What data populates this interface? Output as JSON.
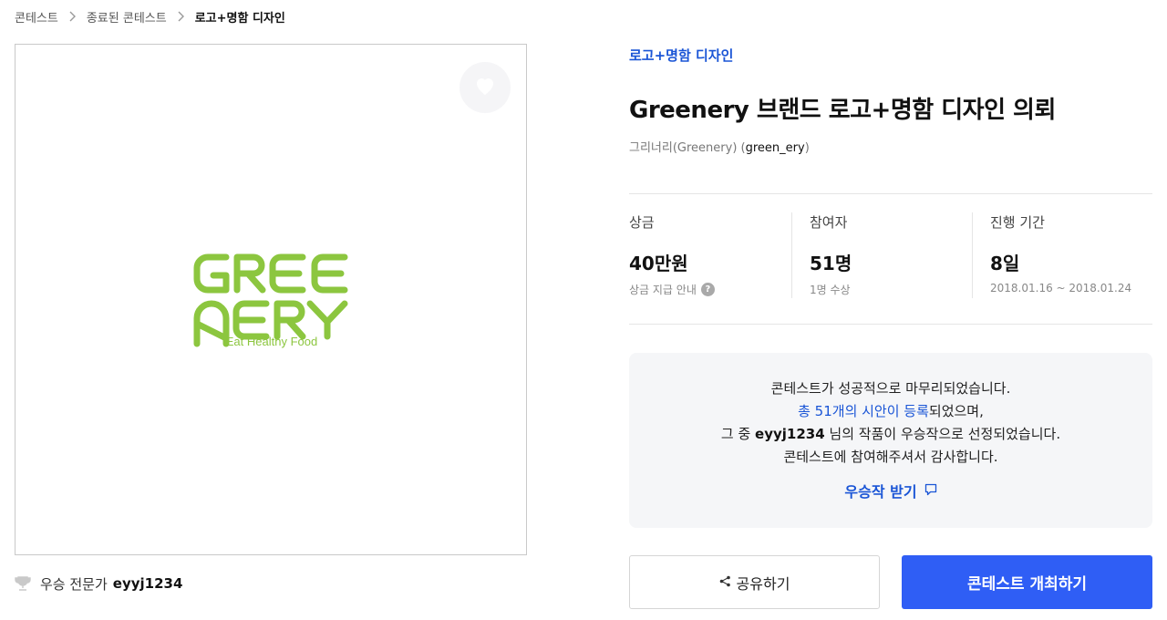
{
  "breadcrumb": {
    "items": [
      "콘테스트",
      "종료된 콘테스트",
      "로고+명함 디자인"
    ]
  },
  "contest": {
    "category": "로고+명함 디자인",
    "title": "Greenery 브랜드 로고+명함 디자인 의뢰",
    "organizer_name": "그리너리(Greenery)",
    "organizer_id": "green_ery"
  },
  "artwork": {
    "logo_line1": "GREE",
    "logo_line2": "NERY",
    "tagline": "Eat Healthy Food",
    "brand_color": "#8cc63f"
  },
  "winner": {
    "label": "우승 전문가",
    "name": "eyyj1234"
  },
  "stats": {
    "prize": {
      "label": "상금",
      "value": "40만원",
      "sub": "상금 지급 안내",
      "help": "?"
    },
    "participants": {
      "label": "참여자",
      "value": "51명",
      "sub": "1명 수상"
    },
    "period": {
      "label": "진행 기간",
      "value": "8일",
      "sub": "2018.01.16 ~ 2018.01.24"
    }
  },
  "result": {
    "line1": "콘테스트가 성공적으로 마무리되었습니다.",
    "line2_link": "총 51개의 시안이 등록",
    "line2_rest": "되었으며,",
    "line3_pre": "그 중 ",
    "line3_id": "eyyj1234",
    "line3_post": " 님의 작품이 우승작으로 선정되었습니다.",
    "line4": "콘테스트에 참여해주셔서 감사합니다.",
    "download_label": "우승작 받기"
  },
  "actions": {
    "share_label": "공유하기",
    "host_label": "콘테스트 개최하기"
  },
  "colors": {
    "accent": "#2f5ef5",
    "link": "#1a55d6"
  }
}
